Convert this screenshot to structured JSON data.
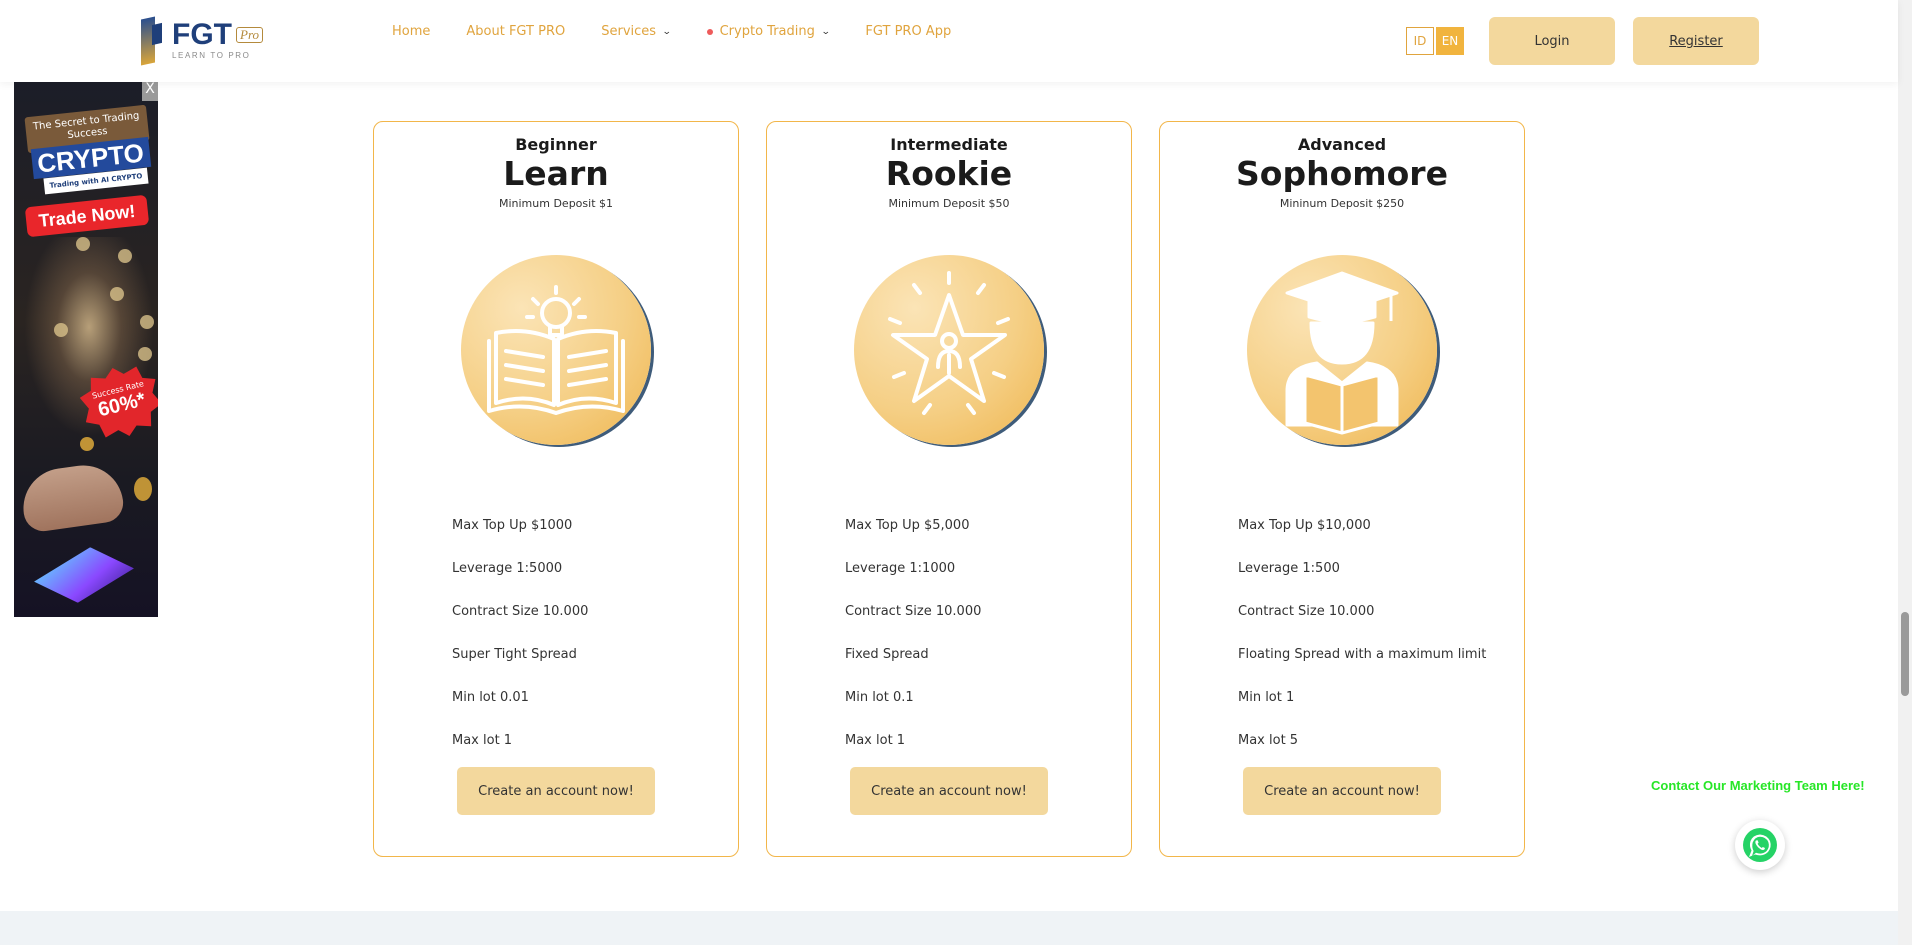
{
  "header": {
    "logo": {
      "brand": "FGT",
      "badge": "Pro",
      "tagline": "LEARN TO PRO"
    },
    "nav": [
      {
        "label": "Home"
      },
      {
        "label": "About FGT PRO"
      },
      {
        "label": "Services",
        "dropdown": true
      },
      {
        "label": "Crypto Trading",
        "dropdown": true,
        "dot_color": "#ee5b5b"
      },
      {
        "label": "FGT PRO App"
      }
    ],
    "languages": [
      {
        "code": "ID",
        "active": false
      },
      {
        "code": "EN",
        "active": true
      }
    ],
    "login_label": "Login",
    "register_label": "Register"
  },
  "ad": {
    "close_label": "X",
    "headline": "The Secret to Trading Success",
    "brand": "CRYPTO",
    "subline": "Trading with AI CRYPTO",
    "cta": "Trade Now!",
    "rate_label": "Success Rate",
    "rate_value": "60%*"
  },
  "plans": [
    {
      "level": "Beginner",
      "name": "Learn",
      "deposit": "Minimum Deposit $1",
      "icon": "open-book-lightbulb-icon",
      "features": [
        "Max Top Up $1000",
        "Leverage 1:5000",
        "Contract Size 10.000",
        "Super Tight Spread",
        "Min lot 0.01",
        "Max lot 1"
      ],
      "cta": "Create an account now!"
    },
    {
      "level": "Intermediate",
      "name": "Rookie",
      "deposit": "Minimum Deposit $50",
      "icon": "star-person-icon",
      "features": [
        "Max Top Up $5,000",
        "Leverage 1:1000",
        "Contract Size 10.000",
        "Fixed Spread",
        "Min lot 0.1",
        "Max lot 1"
      ],
      "cta": "Create an account now!"
    },
    {
      "level": "Advanced",
      "name": "Sophomore",
      "deposit": "Mininum Deposit $250",
      "icon": "graduate-reading-icon",
      "features": [
        "Max Top Up $10,000",
        "Leverage 1:500",
        "Contract Size 10.000",
        "Floating Spread with a maximum limit",
        "Min lot 1",
        "Max lot 5"
      ],
      "cta": "Create an account now!"
    }
  ],
  "contact": {
    "label": "Contact Our Marketing Team Here!",
    "icon": "whatsapp-icon"
  },
  "colors": {
    "accent": "#e0a43e",
    "card_border": "#f2b64a",
    "button_bg": "#f3d89d",
    "contact_text": "#27e627"
  }
}
